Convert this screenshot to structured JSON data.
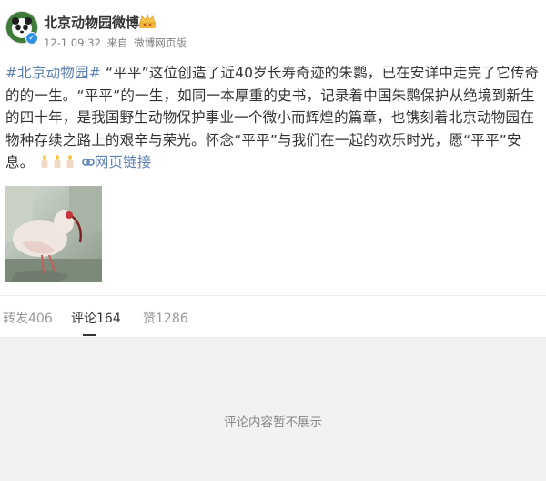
{
  "header": {
    "username": "北京动物园微博",
    "time": "12-1 09:32",
    "source_prefix": "来自",
    "source": "微博网页版"
  },
  "post": {
    "hashtag": "#北京动物园#",
    "body": " “平平”这位创造了近40岁长寿奇迹的朱鹮，已在安详中走完了它传奇的的一生。“平平”的一生，如同一本厚重的史书，记录着中国朱鹮保护从绝境到新生的四十年，是我国野生动物保护事业一个微小而辉煌的篇章，也镌刻着北京动物园在物种存续之路上的艰辛与荣光。怀念“平平”与我们在一起的欢乐时光，愿“平平”安息。",
    "emoji": [
      "candle-emoji",
      "candle-emoji",
      "candle-emoji"
    ],
    "link_label": "网页链接"
  },
  "tabs": [
    {
      "label": "转发406"
    },
    {
      "label": "评论164"
    },
    {
      "label": "赞1286"
    }
  ],
  "comments": {
    "empty_text": "评论内容暂不展示"
  },
  "colors": {
    "link": "#5a7fb5",
    "verified": "#2f8fe6",
    "comment_bg": "#f2f2f2"
  }
}
